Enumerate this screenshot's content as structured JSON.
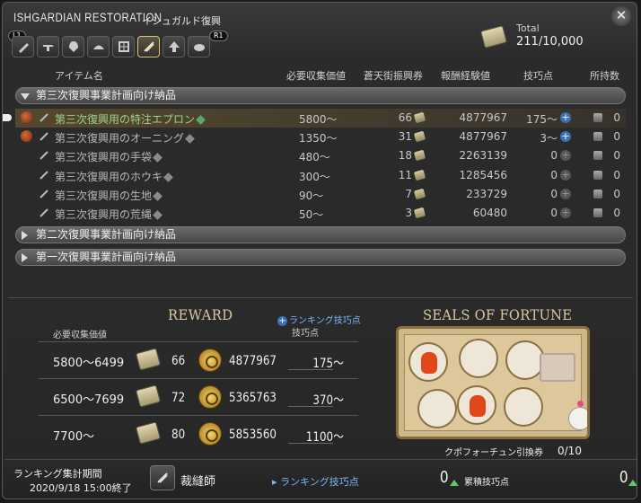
{
  "window": {
    "title": "ISHGARDIAN RESTORATION",
    "subtitle": "イシュガルド復興",
    "close_icon": "close-icon"
  },
  "total": {
    "label": "Total",
    "value": "211/10,000"
  },
  "class_bar": {
    "key_left": "L1",
    "key_right": "R1",
    "classes": [
      {
        "icon": "carpenter-icon"
      },
      {
        "icon": "blacksmith-icon"
      },
      {
        "icon": "armorer-icon"
      },
      {
        "icon": "goldsmith-icon"
      },
      {
        "icon": "leatherworker-icon"
      },
      {
        "icon": "weaver-icon",
        "active": true
      },
      {
        "icon": "alchemist-icon"
      },
      {
        "icon": "culinarian-icon"
      }
    ]
  },
  "columns": {
    "item": "アイテム名",
    "collectability": "必要収集価値",
    "seals": "蒼天街振興券",
    "exp": "報酬経験値",
    "skill": "技巧点",
    "owned": "所持数"
  },
  "sections": [
    {
      "label": "第三次復興事業計画向け納品",
      "expanded": true,
      "items": [
        {
          "name": "第三次復興用の特注エプロン",
          "collect": "5800〜",
          "seals": "66",
          "exp": "4877967",
          "skill": "175〜",
          "owned": "0",
          "highlight": true,
          "has_bag": true
        },
        {
          "name": "第三次復興用のオーニング",
          "collect": "1350〜",
          "seals": "31",
          "exp": "4877967",
          "skill": "3〜",
          "owned": "0",
          "highlight": false,
          "has_bag": true
        },
        {
          "name": "第三次復興用の手袋",
          "collect": "480〜",
          "seals": "18",
          "exp": "2263139",
          "skill": "0",
          "owned": "0",
          "highlight": false,
          "has_bag": false
        },
        {
          "name": "第三次復興用のホウキ",
          "collect": "300〜",
          "seals": "11",
          "exp": "1285456",
          "skill": "0",
          "owned": "0",
          "highlight": false,
          "has_bag": false
        },
        {
          "name": "第三次復興用の生地",
          "collect": "90〜",
          "seals": "7",
          "exp": "233729",
          "skill": "0",
          "owned": "0",
          "highlight": false,
          "has_bag": false
        },
        {
          "name": "第三次復興用の荒縄",
          "collect": "50〜",
          "seals": "3",
          "exp": "60480",
          "skill": "0",
          "owned": "0",
          "highlight": false,
          "has_bag": false
        }
      ]
    },
    {
      "label": "第二次復興事業計画向け納品",
      "expanded": false
    },
    {
      "label": "第一次復興事業計画向け納品",
      "expanded": false
    }
  ],
  "reward": {
    "title": "REWARD",
    "ranking_label": "ランキング技巧点",
    "col_collect": "必要収集価値",
    "col_skill": "技巧点",
    "rows": [
      {
        "range": "5800〜6499",
        "seals": "66",
        "exp": "4877967",
        "skill": "175〜"
      },
      {
        "range": "6500〜7699",
        "seals": "72",
        "exp": "5365763",
        "skill": "370〜"
      },
      {
        "range": "7700〜",
        "seals": "80",
        "exp": "5853560",
        "skill": "1100〜"
      }
    ]
  },
  "fortune": {
    "title": "SEALS OF FORTUNE",
    "coupon_label": "クポフォーチュン引換券",
    "coupon_value": "0/10"
  },
  "footer": {
    "period_label": "ランキング集計期間",
    "period_value": "2020/9/18 15:00終了",
    "job_name": "裁縫師",
    "rank_label": "ランキング技巧点",
    "rank_value": "0",
    "total_label": "累積技巧点",
    "total_value": "0"
  },
  "colors": {
    "accent_blue": "#7ab8ff",
    "gold": "#d9c9a0",
    "highlight_row": "#785f32",
    "up_arrow": "#5fc86a"
  }
}
